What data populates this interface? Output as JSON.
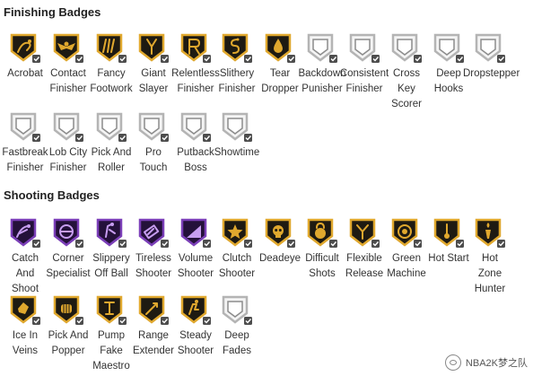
{
  "finishing": {
    "title": "Finishing Badges",
    "badges": [
      {
        "label": "Acrobat",
        "tier": "gold",
        "glyph": "acrobat-icon"
      },
      {
        "label": "Contact\nFinisher",
        "tier": "gold",
        "glyph": "wings-icon"
      },
      {
        "label": "Fancy\nFootwork",
        "tier": "gold",
        "glyph": "footwork-icon"
      },
      {
        "label": "Giant\nSlayer",
        "tier": "gold",
        "glyph": "slingshot-icon"
      },
      {
        "label": "Relentless\nFinisher",
        "tier": "gold",
        "glyph": "r-icon"
      },
      {
        "label": "Slithery\nFinisher",
        "tier": "gold",
        "glyph": "snake-icon"
      },
      {
        "label": "Tear\nDropper",
        "tier": "gold",
        "glyph": "teardrop-icon"
      },
      {
        "label": "Backdown\nPunisher",
        "tier": "silver",
        "glyph": "locked-icon"
      },
      {
        "label": "Consistent\nFinisher",
        "tier": "silver",
        "glyph": "locked-icon"
      },
      {
        "label": "Cross\nKey\nScorer",
        "tier": "silver",
        "glyph": "locked-icon"
      },
      {
        "label": "Deep\nHooks",
        "tier": "silver",
        "glyph": "locked-icon"
      },
      {
        "label": "Dropstepper",
        "tier": "silver",
        "glyph": "locked-icon"
      },
      {
        "label": "Fastbreak\nFinisher",
        "tier": "silver",
        "glyph": "locked-icon"
      },
      {
        "label": "Lob City\nFinisher",
        "tier": "silver",
        "glyph": "locked-icon"
      },
      {
        "label": "Pick And\nRoller",
        "tier": "silver",
        "glyph": "locked-icon"
      },
      {
        "label": "Pro\nTouch",
        "tier": "silver",
        "glyph": "locked-icon"
      },
      {
        "label": "Putback\nBoss",
        "tier": "silver",
        "glyph": "locked-icon"
      },
      {
        "label": "Showtime",
        "tier": "silver",
        "glyph": "locked-icon"
      }
    ]
  },
  "shooting": {
    "title": "Shooting Badges",
    "badges": [
      {
        "label": "Catch\nAnd\nShoot",
        "tier": "purple",
        "glyph": "catch-icon"
      },
      {
        "label": "Corner\nSpecialist",
        "tier": "purple",
        "glyph": "corner-icon"
      },
      {
        "label": "Slippery\nOff Ball",
        "tier": "purple",
        "glyph": "slippery-icon"
      },
      {
        "label": "Tireless\nShooter",
        "tier": "purple",
        "glyph": "battery-icon"
      },
      {
        "label": "Volume\nShooter",
        "tier": "purple",
        "glyph": "volume-icon"
      },
      {
        "label": "Clutch\nShooter",
        "tier": "gold",
        "glyph": "star-icon"
      },
      {
        "label": "Deadeye",
        "tier": "gold",
        "glyph": "skull-icon"
      },
      {
        "label": "Difficult\nShots",
        "tier": "gold",
        "glyph": "kettlebell-icon"
      },
      {
        "label": "Flexible\nRelease",
        "tier": "gold",
        "glyph": "y-icon"
      },
      {
        "label": "Green\nMachine",
        "tier": "gold",
        "glyph": "machine-icon"
      },
      {
        "label": "Hot Start",
        "tier": "gold",
        "glyph": "thermometer-icon"
      },
      {
        "label": "Hot\nZone\nHunter",
        "tier": "gold",
        "glyph": "torch-icon"
      },
      {
        "label": "Ice In\nVeins",
        "tier": "gold",
        "glyph": "ice-icon"
      },
      {
        "label": "Pick And\nPopper",
        "tier": "gold",
        "glyph": "fist-icon"
      },
      {
        "label": "Pump\nFake\nMaestro",
        "tier": "gold",
        "glyph": "pump-icon"
      },
      {
        "label": "Range\nExtender",
        "tier": "gold",
        "glyph": "extender-icon"
      },
      {
        "label": "Steady\nShooter",
        "tier": "gold",
        "glyph": "steady-icon"
      },
      {
        "label": "Deep\nFades",
        "tier": "silver",
        "glyph": "locked-icon"
      }
    ]
  },
  "colors": {
    "gold": "#e0a82e",
    "gold_dark": "#1e1a12",
    "purple": "#7b3fb8",
    "purple_dark": "#24113a",
    "silver": "#b4b4b4",
    "silver_dark": "#e6e6e6"
  },
  "watermark": {
    "text": "NBA2K梦之队"
  }
}
